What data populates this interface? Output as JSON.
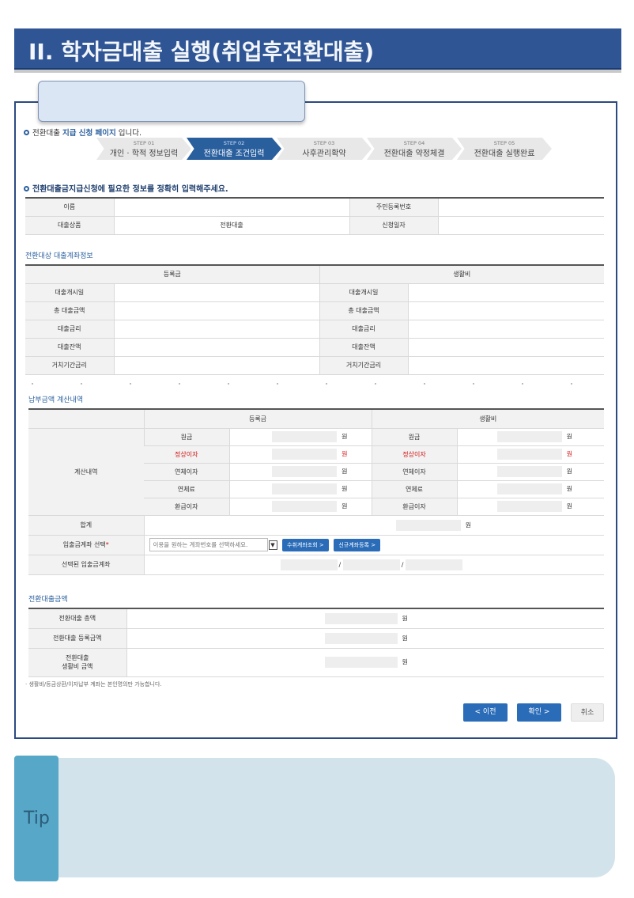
{
  "banner": {
    "title": "II. 학자금대출 실행(취업후전환대출)"
  },
  "notice": {
    "prefix": "전환대출 ",
    "highlight": "지급 신청 페이지",
    "suffix": " 입니다."
  },
  "steps": [
    {
      "num": "STEP 01",
      "label": "개인 · 학적 정보입력",
      "active": false
    },
    {
      "num": "STEP 02",
      "label": "전환대출 조건입력",
      "active": true
    },
    {
      "num": "STEP 03",
      "label": "사후관리확약",
      "active": false
    },
    {
      "num": "STEP 04",
      "label": "전환대출 약정체결",
      "active": false
    },
    {
      "num": "STEP 05",
      "label": "전환대출 실행완료",
      "active": false
    }
  ],
  "info_section": {
    "title": "전환대출금지급신청에 필요한 정보를 정확히 입력해주세요.",
    "name_label": "이름",
    "name_value": "",
    "rrn_label": "주민등록번호",
    "rrn_value": "",
    "product_label": "대출상품",
    "product_value": "전환대출",
    "date_label": "신청일자",
    "date_value": ""
  },
  "account_section": {
    "title": "전환대상 대출계좌정보",
    "col_left": "등록금",
    "col_right": "생활비",
    "rows": [
      "대출개시일",
      "총 대출금액",
      "대출금리",
      "대출잔액",
      "거치기간금리"
    ]
  },
  "payment_section": {
    "title": "납부금액 계산내역",
    "col_left": "등록금",
    "col_right": "생활비",
    "group_label": "계산내역",
    "rows": [
      {
        "label": "원금",
        "red": false
      },
      {
        "label": "정상이자",
        "red": true
      },
      {
        "label": "연체이자",
        "red": false
      },
      {
        "label": "연체료",
        "red": false
      },
      {
        "label": "환급이자",
        "red": false
      }
    ],
    "unit": "원",
    "total_label": "합계",
    "account_select_label": "입출금계좌 선택",
    "account_select_required": "*",
    "account_select_placeholder": "이용을 원하는 계좌번호를 선택하세요.",
    "btn_search": "수취계좌조회 >",
    "btn_register": "신규계좌등록 >",
    "selected_account_label": "선택된 입출금계좌",
    "slash": "/"
  },
  "amount_section": {
    "title": "전환대출금액",
    "rows": [
      {
        "label_line1": "전환대출 총액",
        "label_line2": ""
      },
      {
        "label_line1": "전환대출 등록금액",
        "label_line2": ""
      },
      {
        "label_line1": "전환대출",
        "label_line2": "생활비 금액"
      }
    ],
    "unit": "원"
  },
  "footnote": "· 생활비/등금상환/이자납부 계좌는 본인명의만 가능합니다.",
  "buttons": {
    "prev": "<  이전",
    "confirm": "확인  >",
    "cancel": "취소"
  },
  "tip": {
    "label": "Tip"
  },
  "colors": {
    "brand": "#2f5595",
    "accent": "#2a6cb8",
    "tip": "#57a7c8"
  }
}
